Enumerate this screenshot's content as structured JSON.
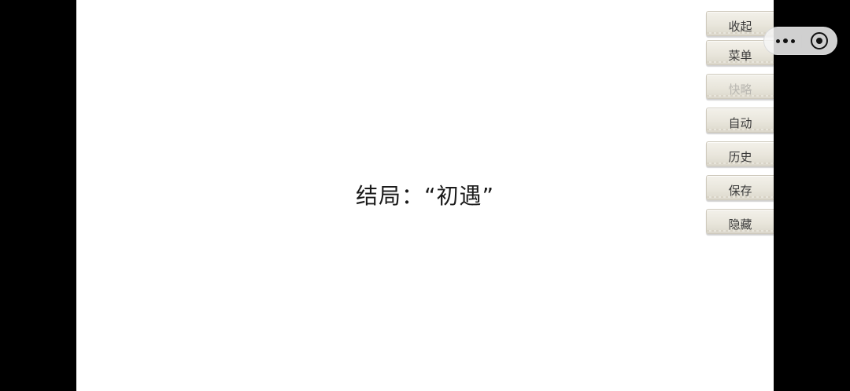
{
  "scene": {
    "ending_text": "结局：“初遇”"
  },
  "menu": {
    "items": [
      {
        "id": "collapse",
        "label": "收起",
        "enabled": true
      },
      {
        "id": "menu",
        "label": "菜单",
        "enabled": true
      },
      {
        "id": "quick",
        "label": "快略",
        "enabled": false
      },
      {
        "id": "auto",
        "label": "自动",
        "enabled": true
      },
      {
        "id": "history",
        "label": "历史",
        "enabled": true
      },
      {
        "id": "save",
        "label": "保存",
        "enabled": true
      },
      {
        "id": "hide",
        "label": "隐藏",
        "enabled": true
      }
    ]
  },
  "capsule": {
    "more_icon": "more-dots-icon",
    "close_icon": "target-close-icon"
  },
  "colors": {
    "letterbox": "#000000",
    "stage": "#ffffff",
    "button_text": "#3a3a3a",
    "button_disabled_text": "#b8b6b0"
  }
}
